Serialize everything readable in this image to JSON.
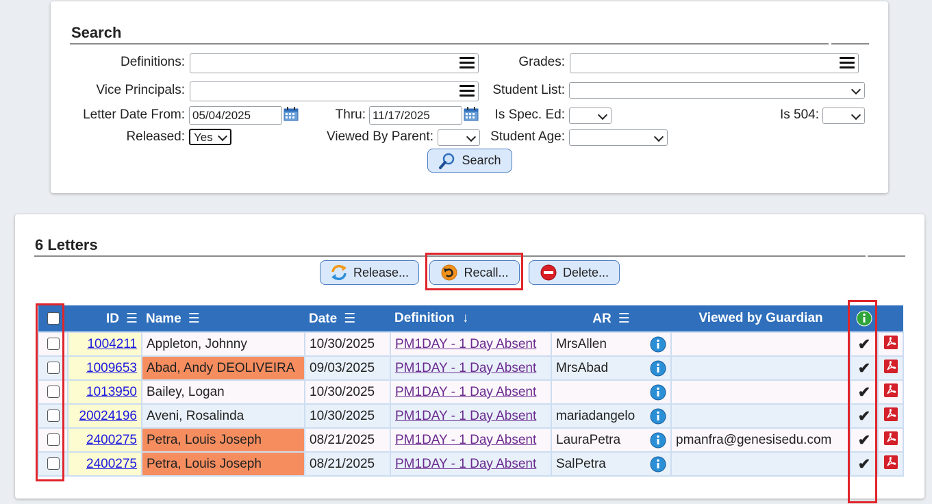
{
  "search": {
    "title": "Search",
    "labels": {
      "definitions": "Definitions:",
      "grades": "Grades:",
      "vice_principals": "Vice Principals:",
      "student_list": "Student List:",
      "letter_date_from": "Letter Date From:",
      "thru": "Thru:",
      "is_spec_ed": "Is Spec. Ed:",
      "is_504": "Is 504:",
      "released": "Released:",
      "viewed_by_parent": "Viewed By Parent:",
      "student_age": "Student Age:"
    },
    "values": {
      "letter_date_from": "05/04/2025",
      "thru": "11/17/2025",
      "released": "Yes"
    },
    "search_button": "Search"
  },
  "letters": {
    "title": "6 Letters",
    "buttons": {
      "release": "Release...",
      "recall": "Recall...",
      "delete": "Delete..."
    },
    "columns": {
      "id": "ID",
      "name": "Name",
      "date": "Date",
      "definition": "Definition",
      "definition_sort": "↓",
      "ar": "AR",
      "viewed_by_guardian": "Viewed by Guardian"
    },
    "rows": [
      {
        "id": "1004211",
        "name": "Appleton, Johnny",
        "date": "10/30/2025",
        "definition": "PM1DAY - 1 Day Absent",
        "ar": "MrsAllen",
        "viewed": "",
        "check": "✔"
      },
      {
        "id": "1009653",
        "name": "Abad, Andy DEOLIVEIRA",
        "date": "09/03/2025",
        "definition": "PM1DAY - 1 Day Absent",
        "ar": "MrsAbad",
        "viewed": "",
        "check": "✔"
      },
      {
        "id": "1013950",
        "name": "Bailey, Logan",
        "date": "10/30/2025",
        "definition": "PM1DAY - 1 Day Absent",
        "ar": "",
        "viewed": "",
        "check": "✔"
      },
      {
        "id": "20024196",
        "name": "Aveni, Rosalinda",
        "date": "10/30/2025",
        "definition": "PM1DAY - 1 Day Absent",
        "ar": "mariadangelo",
        "viewed": "",
        "check": "✔"
      },
      {
        "id": "2400275",
        "name": "Petra, Louis Joseph",
        "date": "08/21/2025",
        "definition": "PM1DAY - 1 Day Absent",
        "ar": "LauraPetra",
        "viewed": "pmanfra@genesisedu.com",
        "check": "✔"
      },
      {
        "id": "2400275",
        "name": "Petra, Louis Joseph",
        "date": "08/21/2025",
        "definition": "PM1DAY - 1 Day Absent",
        "ar": "SalPetra",
        "viewed": "",
        "check": "✔"
      }
    ]
  },
  "colors": {
    "header_blue": "#2f6fbc",
    "highlight_orange": "#f58d5f",
    "id_yellow": "#fdfbd0",
    "annotation_red": "#e0252b"
  }
}
